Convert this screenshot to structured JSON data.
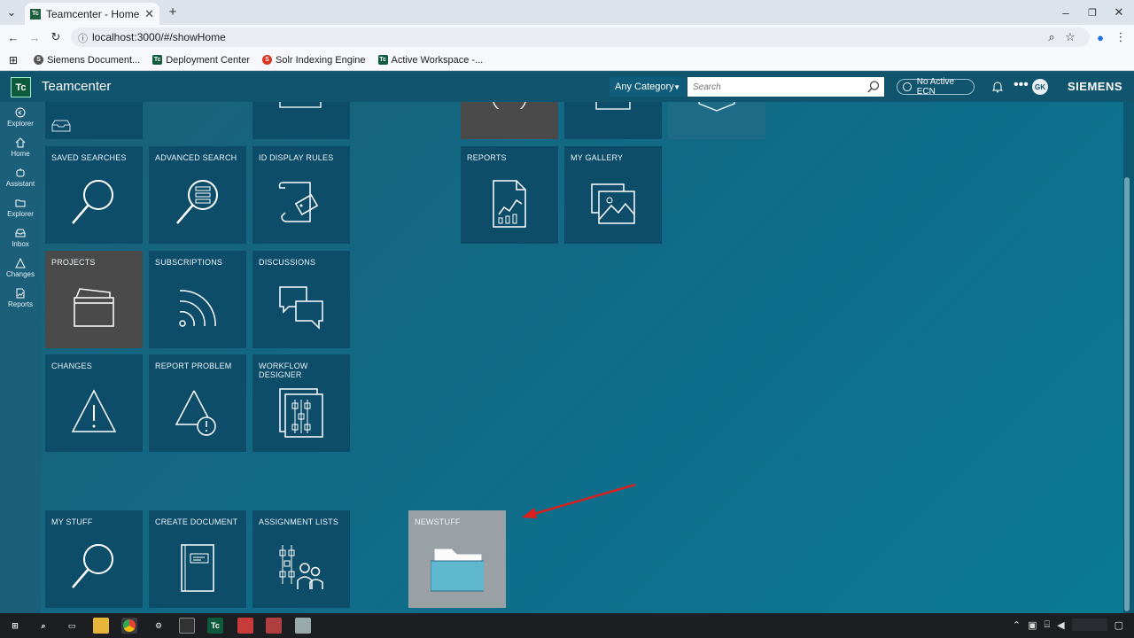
{
  "browser": {
    "tab_title": "Teamcenter - Home",
    "tab_favicon": "Tc",
    "url": "localhost:3000/#/showHome",
    "bookmarks": [
      {
        "label": "Siemens Document...",
        "icon": "S",
        "color": "#555555"
      },
      {
        "label": "Deployment Center",
        "icon": "Tc",
        "color": "#0e5a3c"
      },
      {
        "label": "Solr Indexing Engine",
        "icon": "S",
        "color": "#d9331f"
      },
      {
        "label": "Active Workspace -...",
        "icon": "Tc",
        "color": "#0e5a3c"
      }
    ]
  },
  "header": {
    "logo": "Tc",
    "app_name": "Teamcenter",
    "category": "Any Category",
    "search_placeholder": "Search",
    "ecn_label": "No Active ECN",
    "avatar_initials": "GK",
    "brand": "SIEMENS"
  },
  "leftnav": {
    "items": [
      {
        "label": "Explorer",
        "icon": "explorer-icon"
      },
      {
        "label": "Home",
        "icon": "home-icon"
      },
      {
        "label": "Assistant",
        "icon": "assistant-icon"
      },
      {
        "label": "Explorer",
        "icon": "folder-icon"
      },
      {
        "label": "Inbox",
        "icon": "inbox-icon"
      },
      {
        "label": "Changes",
        "icon": "changes-icon"
      },
      {
        "label": "Reports",
        "icon": "reports-icon"
      }
    ]
  },
  "tiles": {
    "saved_searches": "SAVED SEARCHES",
    "advanced_search": "ADVANCED SEARCH",
    "id_display_rules": "ID DISPLAY RULES",
    "reports": "REPORTS",
    "my_gallery": "MY GALLERY",
    "projects": "PROJECTS",
    "subscriptions": "SUBSCRIPTIONS",
    "discussions": "DISCUSSIONS",
    "changes": "CHANGES",
    "report_problem": "REPORT PROBLEM",
    "workflow_designer": "WORKFLOW DESIGNER",
    "my_stuff": "MY STUFF",
    "create_document": "CREATE DOCUMENT",
    "assignment_lists": "ASSIGNMENT LISTS",
    "newstuff": "NEWSTUFF"
  },
  "colors": {
    "tile": "#0d4d6a",
    "tile_highlight": "#4a4a4a",
    "tile_selected": "#9aa1a4",
    "annotation_arrow": "#d9201f"
  }
}
